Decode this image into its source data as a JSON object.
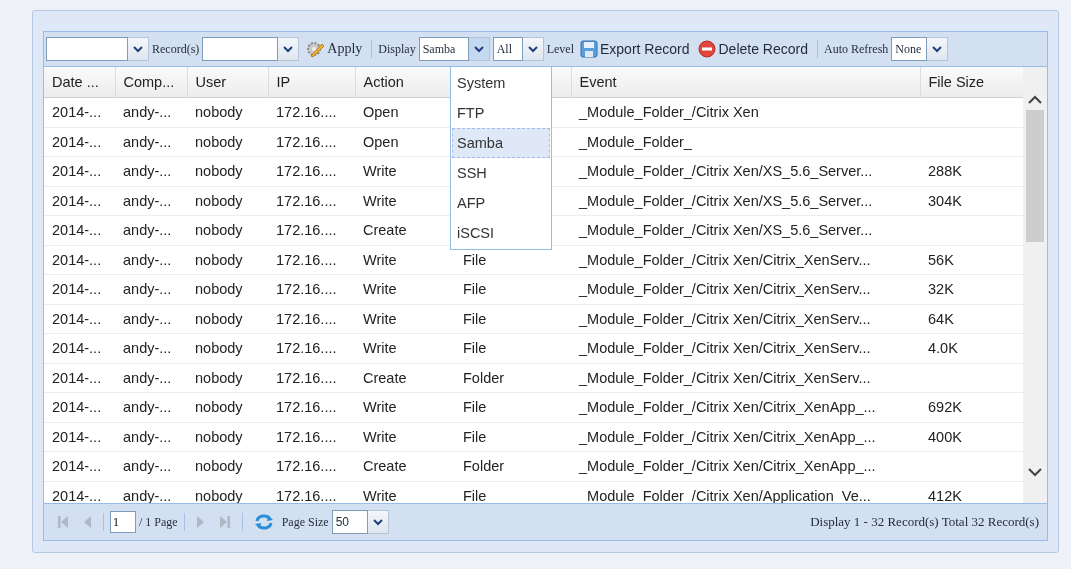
{
  "toolbar": {
    "record_label": "Record(s)",
    "apply_button": "Apply",
    "display_label": "Display",
    "display_field": {
      "value": "Samba",
      "expanded": true
    },
    "level_field": {
      "value": "All"
    },
    "level_label": "Level",
    "export_button": "Export Record",
    "delete_button": "Delete Record",
    "auto_refresh_label": "Auto Refresh",
    "auto_refresh_field": {
      "value": "None"
    }
  },
  "display_menu": [
    {
      "label": "System",
      "selected": false
    },
    {
      "label": "FTP",
      "selected": false
    },
    {
      "label": "Samba",
      "selected": true
    },
    {
      "label": "SSH",
      "selected": false
    },
    {
      "label": "AFP",
      "selected": false
    },
    {
      "label": "iSCSI",
      "selected": false
    }
  ],
  "table": {
    "columns": [
      "Date ...",
      "Comp...",
      "User",
      "IP",
      "Action",
      null,
      "Event",
      "File Size"
    ],
    "rows": [
      [
        "2014-...",
        "andy-...",
        "nobody",
        "172.16....",
        "Open",
        null,
        "_Module_Folder_/Citrix Xen",
        null
      ],
      [
        "2014-...",
        "andy-...",
        "nobody",
        "172.16....",
        "Open",
        null,
        "_Module_Folder_",
        null
      ],
      [
        "2014-...",
        "andy-...",
        "nobody",
        "172.16....",
        "Write",
        null,
        "_Module_Folder_/Citrix Xen/XS_5.6_Server...",
        "288K"
      ],
      [
        "2014-...",
        "andy-...",
        "nobody",
        "172.16....",
        "Write",
        null,
        "_Module_Folder_/Citrix Xen/XS_5.6_Server...",
        "304K"
      ],
      [
        "2014-...",
        "andy-...",
        "nobody",
        "172.16....",
        "Create",
        null,
        "_Module_Folder_/Citrix Xen/XS_5.6_Server...",
        null
      ],
      [
        "2014-...",
        "andy-...",
        "nobody",
        "172.16....",
        "Write",
        "File",
        "_Module_Folder_/Citrix Xen/Citrix_XenServ...",
        "56K"
      ],
      [
        "2014-...",
        "andy-...",
        "nobody",
        "172.16....",
        "Write",
        "File",
        "_Module_Folder_/Citrix Xen/Citrix_XenServ...",
        "32K"
      ],
      [
        "2014-...",
        "andy-...",
        "nobody",
        "172.16....",
        "Write",
        "File",
        "_Module_Folder_/Citrix Xen/Citrix_XenServ...",
        "64K"
      ],
      [
        "2014-...",
        "andy-...",
        "nobody",
        "172.16....",
        "Write",
        "File",
        "_Module_Folder_/Citrix Xen/Citrix_XenServ...",
        "4.0K"
      ],
      [
        "2014-...",
        "andy-...",
        "nobody",
        "172.16....",
        "Create",
        "Folder",
        "_Module_Folder_/Citrix Xen/Citrix_XenServ...",
        null
      ],
      [
        "2014-...",
        "andy-...",
        "nobody",
        "172.16....",
        "Write",
        "File",
        "_Module_Folder_/Citrix Xen/Citrix_XenApp_...",
        "692K"
      ],
      [
        "2014-...",
        "andy-...",
        "nobody",
        "172.16....",
        "Write",
        "File",
        "_Module_Folder_/Citrix Xen/Citrix_XenApp_...",
        "400K"
      ],
      [
        "2014-...",
        "andy-...",
        "nobody",
        "172.16....",
        "Create",
        "Folder",
        "_Module_Folder_/Citrix Xen/Citrix_XenApp_...",
        null
      ],
      [
        "2014-...",
        "andy-...",
        "nobody",
        "172.16....",
        "Write",
        "File",
        "_Module_Folder_/Citrix Xen/Application_Ve...",
        "412K"
      ]
    ]
  },
  "pager": {
    "first_disabled": true,
    "prev_disabled": true,
    "page_field": {
      "value": "1"
    },
    "page_label": "/ 1 Page",
    "next_disabled": true,
    "last_disabled": true,
    "page_size_label": "Page Size",
    "page_size_field": {
      "value": "50"
    },
    "status": "Display 1 - 32 Record(s) Total 32 Record(s)"
  }
}
